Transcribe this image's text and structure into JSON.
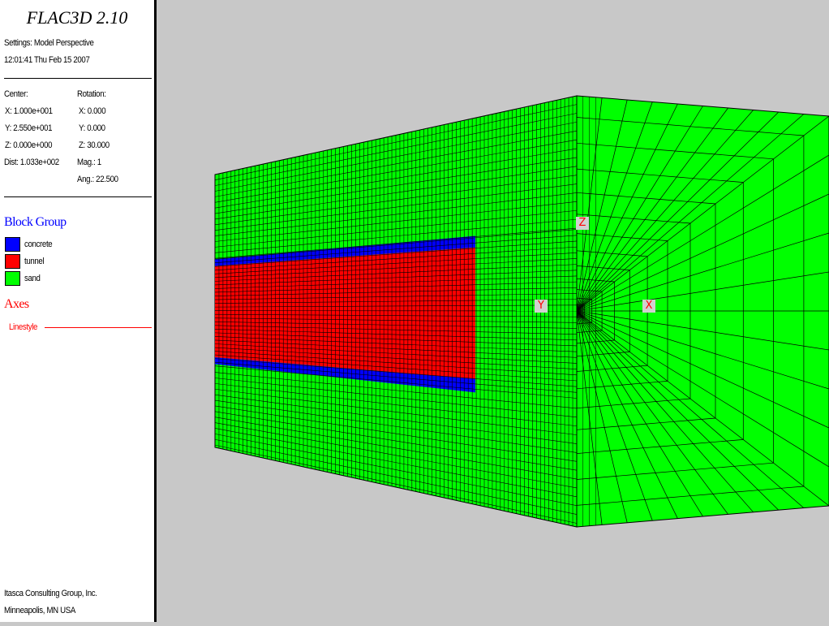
{
  "app": {
    "title": "FLAC3D 2.10"
  },
  "header": {
    "settings": "Settings: Model Perspective",
    "timestamp": "12:01:41 Thu Feb 15 2007"
  },
  "view": {
    "center_label": "Center:",
    "center": {
      "x": "X: 1.000e+001",
      "y": "Y: 2.550e+001",
      "z": "Z: 0.000e+000"
    },
    "dist": "Dist: 1.033e+002",
    "rotation_label": "Rotation:",
    "rotation": {
      "x": "X:  0.000",
      "y": "Y:  0.000",
      "z": "Z: 30.000"
    },
    "mag": "Mag.:      1",
    "ang": "Ang.: 22.500"
  },
  "legend": {
    "block_group_title": "Block Group",
    "groups": [
      {
        "label": "concrete",
        "color": "#0000ff"
      },
      {
        "label": "tunnel",
        "color": "#ff0000"
      },
      {
        "label": "sand",
        "color": "#00ff00"
      }
    ],
    "axes_title": "Axes",
    "linestyle_label": "Linestyle",
    "axes_color": "#ff0000",
    "block_group_color": "#0000ff"
  },
  "axes_markers": {
    "x": "X",
    "y": "Y",
    "z": "Z"
  },
  "footer": {
    "company": "Itasca Consulting Group, Inc.",
    "location": "Minneapolis, MN USA"
  },
  "colors": {
    "background": "#c8c8c8",
    "sand": "#00ff00",
    "tunnel": "#ff0000",
    "concrete": "#0000ff",
    "grid_lines": "#000000"
  }
}
